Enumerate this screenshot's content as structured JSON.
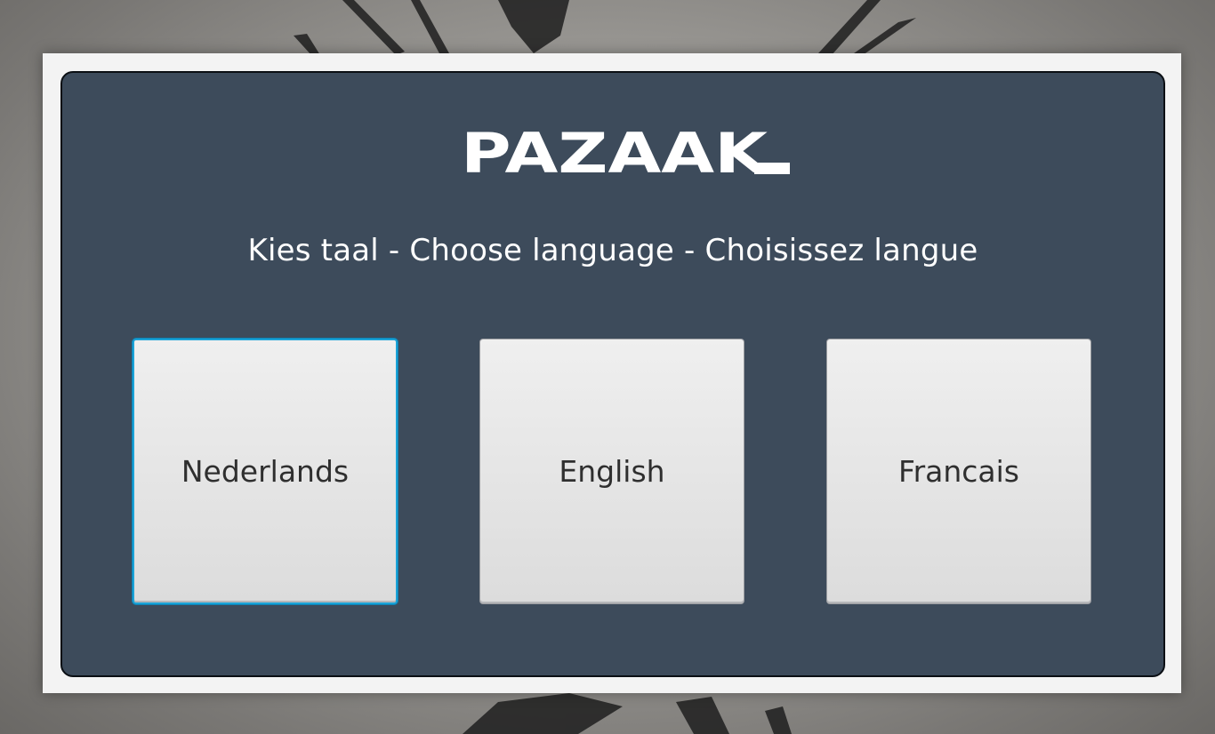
{
  "app": {
    "logo_text": "PAZAAK",
    "prompt": "Kies taal - Choose language - Choisissez langue"
  },
  "languages": [
    {
      "label": "Nederlands",
      "focused": true
    },
    {
      "label": "English",
      "focused": false
    },
    {
      "label": "Francais",
      "focused": false
    }
  ],
  "colors": {
    "panel": "#3d4b5b",
    "frame": "#f3f3f3",
    "button": "#e6e6e6",
    "focus_ring": "#1aa3d8",
    "text_light": "#ffffff",
    "text_dark": "#2f2f2f"
  }
}
